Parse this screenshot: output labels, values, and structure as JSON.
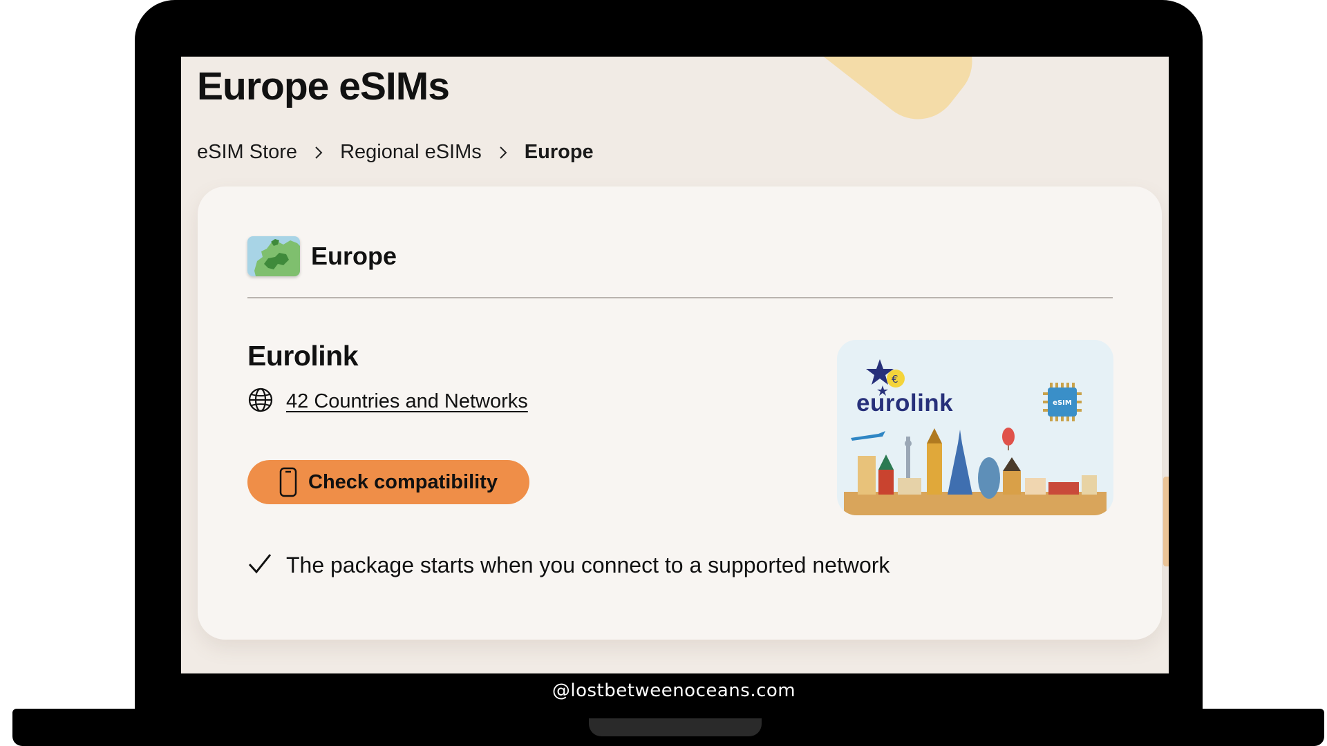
{
  "page": {
    "title": "Europe eSIMs",
    "breadcrumb": [
      "eSIM Store",
      "Regional eSIMs",
      "Europe"
    ]
  },
  "region": {
    "name": "Europe"
  },
  "product": {
    "name": "Eurolink",
    "coverage_link": "42 Countries and Networks",
    "check_button": "Check compatibility",
    "feature": "The package starts when you connect to a supported network",
    "image": {
      "brand": "eurolink",
      "chip_label": "eSIM"
    }
  },
  "watermark": "@lostbetweenoceans.com",
  "colors": {
    "screen_bg": "#f1ebe5",
    "card_bg": "#f8f5f2",
    "button": "#ef8e48",
    "brand_blue": "#27307a"
  },
  "icons": [
    "europe-map-icon",
    "globe-icon",
    "phone-icon",
    "checkmark-icon",
    "chevron-right-icon",
    "esim-chip-icon"
  ]
}
